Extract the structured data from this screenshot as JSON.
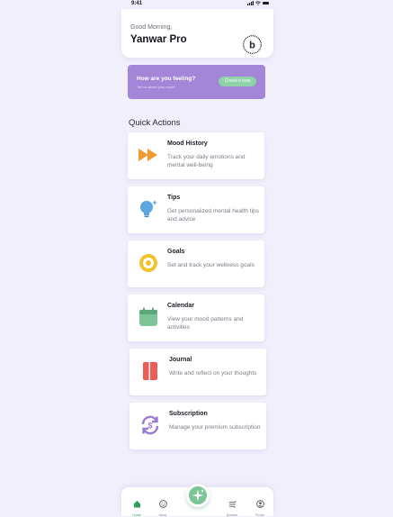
{
  "status_bar": {
    "time": "9:41"
  },
  "header": {
    "greeting": "Good Morning,",
    "user_name": "Yanwar Pro",
    "logo_letter": "b"
  },
  "feeling_card": {
    "title": "How are you feeling?",
    "subtitle": "Tell us about your mood",
    "button_label": "Check it now"
  },
  "quick_actions": {
    "title": "Quick Actions",
    "items": [
      {
        "title": "Mood History",
        "desc": "Track your daily emotions and mental well-being",
        "icon": "fast-forward-icon",
        "color": "#f29a2e"
      },
      {
        "title": "Tips",
        "desc": "Get personalized mental health tips and advice",
        "icon": "lightbulb-icon",
        "color": "#5ea6e0"
      },
      {
        "title": "Goals",
        "desc": "Set and track your wellness goals",
        "icon": "target-icon",
        "color": "#f2c230"
      },
      {
        "title": "Calendar",
        "desc": "View your mood patterns and activities",
        "icon": "calendar-icon",
        "color": "#7cc596"
      },
      {
        "title": "Journal",
        "desc": "Write and reflect on your thoughts",
        "icon": "journal-icon",
        "color": "#ee5c55"
      },
      {
        "title": "Subscription",
        "desc": "Manage your premium subscription",
        "icon": "subscription-cycle-icon",
        "color": "#9a7ccf"
      }
    ]
  },
  "bottom_nav": {
    "items": [
      {
        "label": "Home",
        "icon": "home-icon",
        "active": true
      },
      {
        "label": "Mood",
        "icon": "mood-face-icon",
        "active": false
      },
      {
        "label": "Breathe",
        "icon": "breathe-icon",
        "active": false
      },
      {
        "label": "Profile",
        "icon": "profile-icon",
        "active": false
      }
    ],
    "fab_icon": "sparkle-icon"
  },
  "colors": {
    "background": "#f1effc",
    "accent_purple": "#a386d8",
    "accent_green": "#7cc596"
  }
}
